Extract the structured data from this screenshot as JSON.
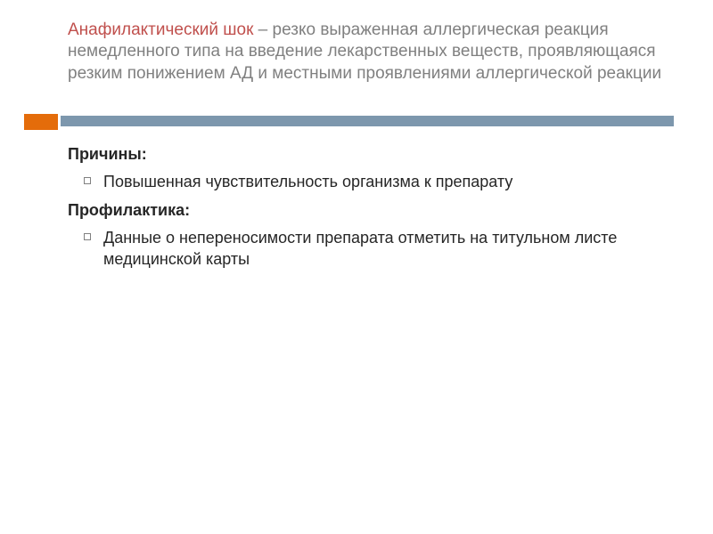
{
  "title": {
    "term": "Анафилактический шок",
    "definition": " – резко выраженная аллергическая реакция немедленного типа на введение лекарственных веществ, проявляющаяся резким понижением АД и местными проявлениями аллергической реакции"
  },
  "body": {
    "causes_heading": "Причины:",
    "causes_items": [
      "Повышенная чувствительность организма к препарату"
    ],
    "prevention_heading": "Профилактика:",
    "prevention_items": [
      "Данные о непереносимости препарата отметить на титульном листе медицинской карты"
    ]
  },
  "colors": {
    "accent": "#e46c0a",
    "bar": "#7d97ad",
    "term": "#c0504d",
    "subtitle": "#808080"
  }
}
